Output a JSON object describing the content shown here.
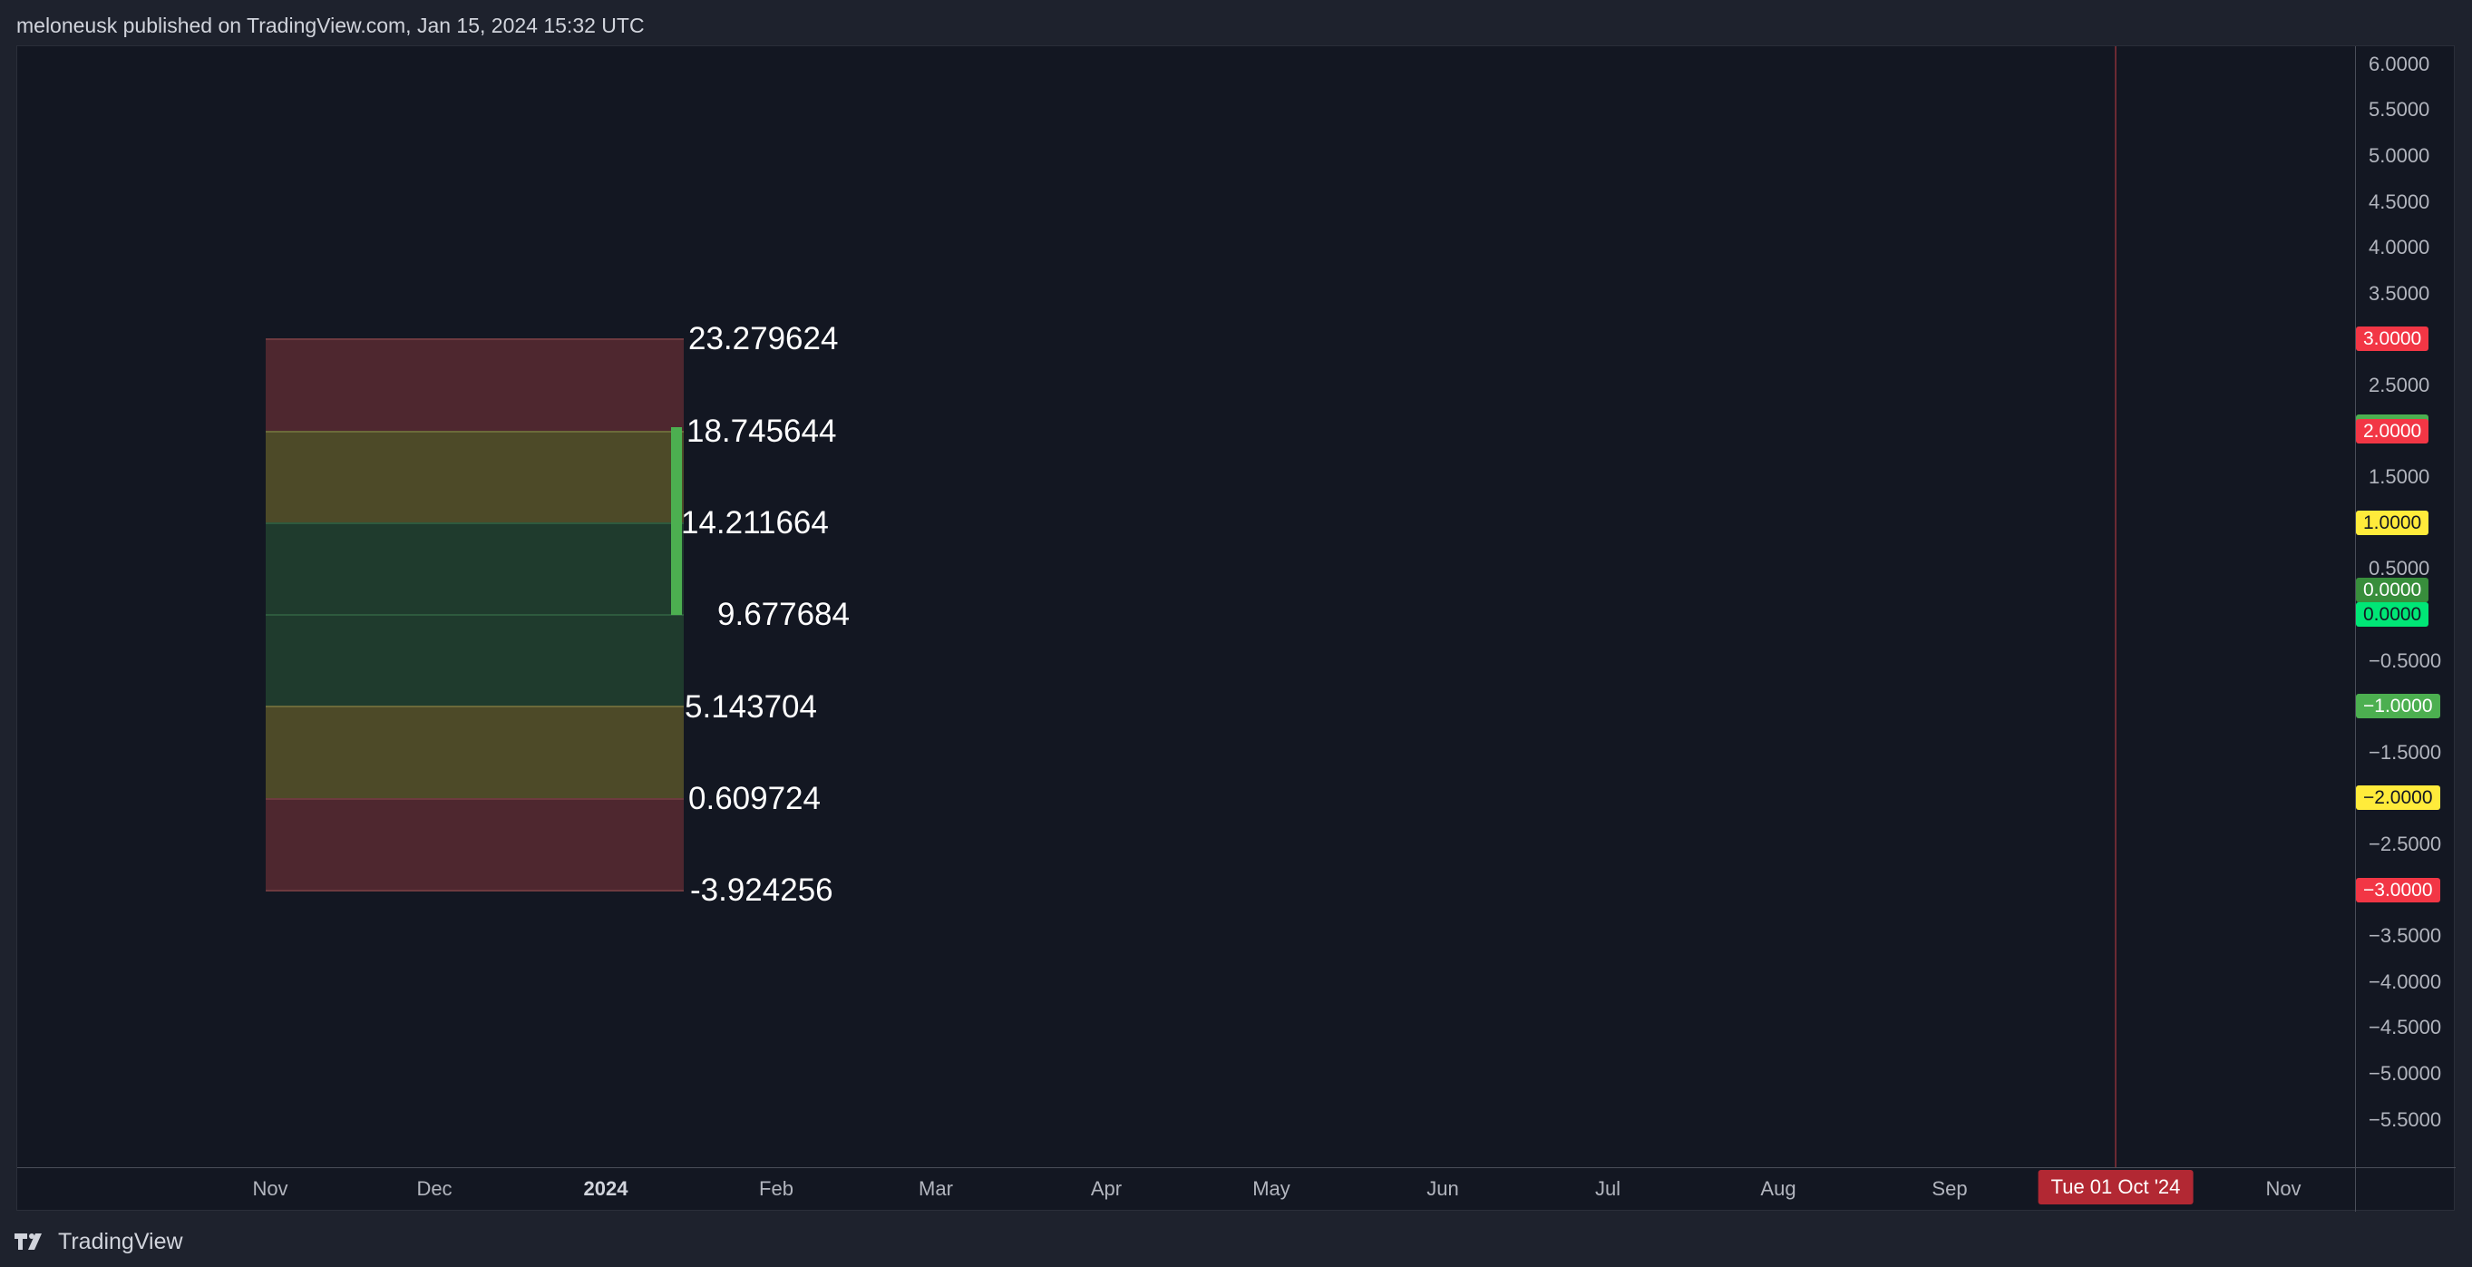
{
  "header": {
    "text": "meloneusk published on TradingView.com, Jan 15, 2024 15:32 UTC"
  },
  "indicator": {
    "levels": [
      {
        "label": "23.279624"
      },
      {
        "label": "18.745644"
      },
      {
        "label": "14.211664"
      },
      {
        "label": "9.677684"
      },
      {
        "label": "5.143704"
      },
      {
        "label": "0.609724"
      },
      {
        "label": "-3.924256"
      }
    ],
    "zones": [
      {
        "zone": "red",
        "color": "#4e272f"
      },
      {
        "zone": "yellow",
        "color": "#4d4a28"
      },
      {
        "zone": "green",
        "color": "#1f3b2d"
      },
      {
        "zone": "green",
        "color": "#1f3b2d"
      },
      {
        "zone": "yellow",
        "color": "#4d4a28"
      },
      {
        "zone": "red",
        "color": "#4e272f"
      }
    ],
    "bar_value": 2.0427,
    "bar_color": "#4caf50"
  },
  "price_axis": {
    "ticks": [
      "6.0000",
      "5.5000",
      "5.0000",
      "4.5000",
      "4.0000",
      "3.5000",
      "2.5000",
      "1.5000",
      "0.5000",
      "−0.5000",
      "−1.5000",
      "−2.5000",
      "−3.5000",
      "−4.0000",
      "−4.5000",
      "−5.0000",
      "−5.5000"
    ],
    "badges": [
      {
        "text": "3.0000",
        "bg": "#f23645",
        "fg": "#ffffff"
      },
      {
        "text": "2.0427",
        "bg": "#4caf50",
        "fg": "#ffffff"
      },
      {
        "text": "2.0000",
        "bg": "#f23645",
        "fg": "#ffffff"
      },
      {
        "text": "1.0000",
        "bg": "#ffeb3b",
        "fg": "#131722"
      },
      {
        "text": "0.0000",
        "bg": "#388e3c",
        "fg": "#ffffff"
      },
      {
        "text": "0.0000",
        "bg": "#00e676",
        "fg": "#131722"
      },
      {
        "text": "−1.0000",
        "bg": "#4caf50",
        "fg": "#ffffff"
      },
      {
        "text": "−2.0000",
        "bg": "#ffeb3b",
        "fg": "#131722"
      },
      {
        "text": "−3.0000",
        "bg": "#f23645",
        "fg": "#ffffff"
      }
    ]
  },
  "time_axis": {
    "ticks": [
      {
        "label": "Nov"
      },
      {
        "label": "Dec"
      },
      {
        "label": "2024",
        "bold": true
      },
      {
        "label": "Feb"
      },
      {
        "label": "Mar"
      },
      {
        "label": "Apr"
      },
      {
        "label": "May"
      },
      {
        "label": "Jun"
      },
      {
        "label": "Jul"
      },
      {
        "label": "Aug"
      },
      {
        "label": "Sep"
      },
      {
        "label": "Nov"
      }
    ],
    "crosshair_label": "Tue 01 Oct '24"
  },
  "footer": {
    "brand": "TradingView",
    "logo_icon": "tradingview-logo-icon"
  }
}
